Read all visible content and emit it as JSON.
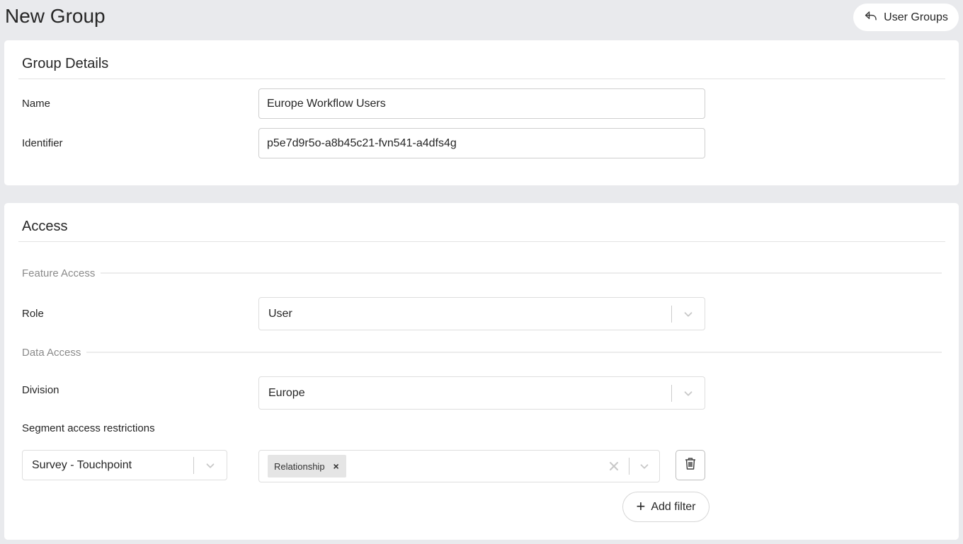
{
  "header": {
    "title": "New Group",
    "back_label": "User Groups",
    "back_icon": "reply-arrow-icon"
  },
  "group_details": {
    "title": "Group Details",
    "name_label": "Name",
    "name_value": "Europe Workflow Users",
    "identifier_label": "Identifier",
    "identifier_value": "p5e7d9r5o-a8b45c21-fvn541-a4dfs4g"
  },
  "access": {
    "title": "Access",
    "feature_access_heading": "Feature Access",
    "role_label": "Role",
    "role_value": "User",
    "data_access_heading": "Data Access",
    "division_label": "Division",
    "division_value": "Europe",
    "segment_label": "Segment access restrictions",
    "segment_field_value": "Survey - Touchpoint",
    "segment_tags": [
      "Relationship"
    ],
    "add_filter_label": "Add filter"
  },
  "colors": {
    "page_bg": "#e9eaed",
    "card_bg": "#ffffff",
    "text": "#262626",
    "muted": "#8a8a8a",
    "tag_bg": "#e5e5e5"
  }
}
